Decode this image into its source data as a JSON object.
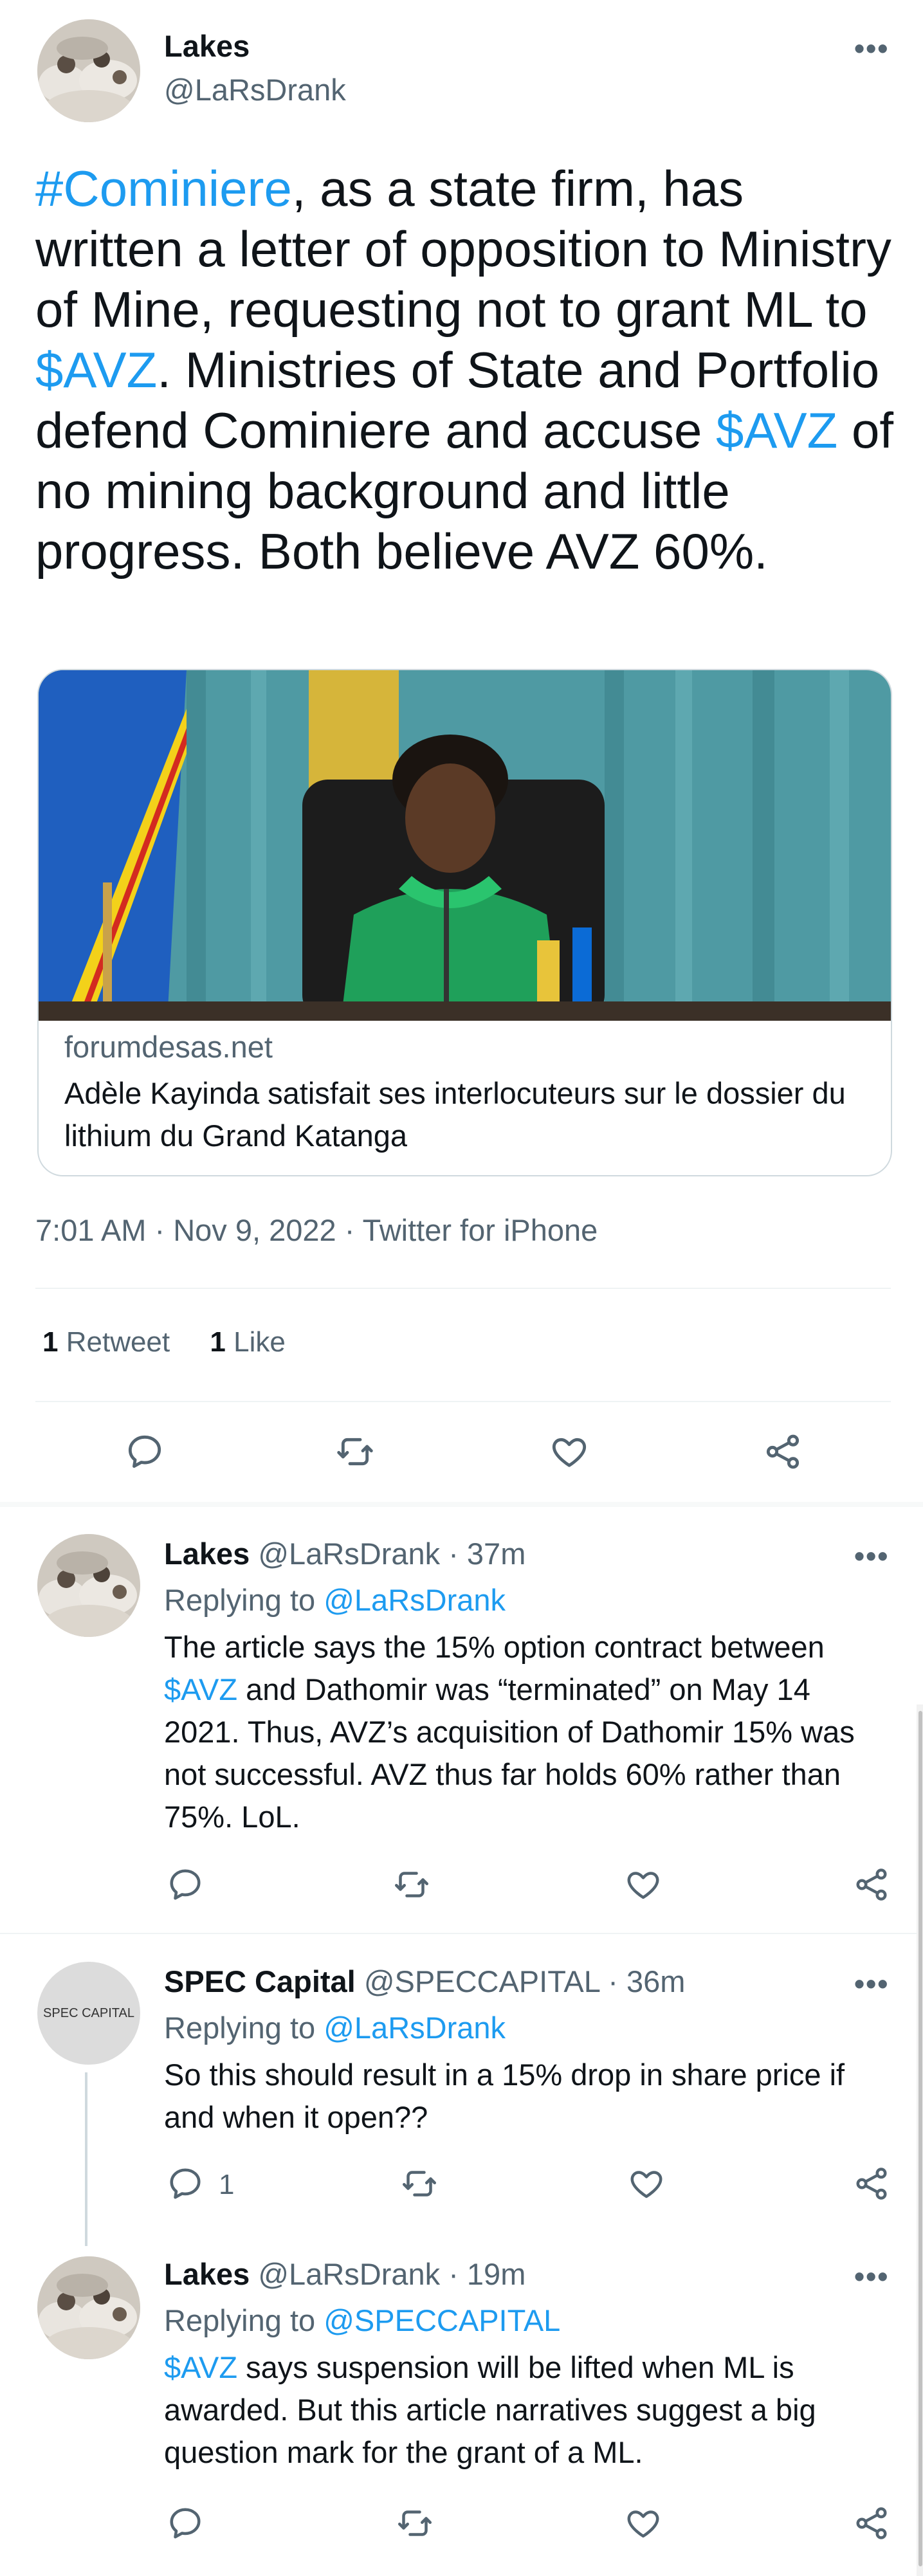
{
  "main_tweet": {
    "author_name": "Lakes",
    "author_handle": "@LaRsDrank",
    "text_parts": [
      "#Cominiere",
      ", as a state firm, has written a letter of opposition to Ministry of Mine, requesting not to grant ML to ",
      "$AVZ",
      ". Ministries of State and Portfolio defend Cominiere and accuse ",
      "$AVZ",
      " of no mining background and little progress.  Both believe AVZ 60%."
    ],
    "card": {
      "domain": "forumdesas.net",
      "title": "Adèle Kayinda satisfait ses interlocuteurs sur le dossier du lithium du Grand Katanga"
    },
    "timestamp": "7:01 AM · Nov 9, 2022 · Twitter for iPhone",
    "retweets_count": "1",
    "retweets_label": "Retweet",
    "likes_count": "1",
    "likes_label": "Like"
  },
  "replies": [
    {
      "author_name": "Lakes",
      "author_handle": "@LaRsDrank · 37m",
      "replying_prefix": "Replying to ",
      "replying_to": "@LaRsDrank",
      "text_parts": [
        "The article says the 15% option contract between ",
        "$AVZ",
        " and Dathomir was “terminated” on May 14 2021. Thus, AVZ’s acquisition of Dathomir 15% was not successful. AVZ thus far holds 60% rather than 75%. LoL."
      ],
      "reply_count": ""
    },
    {
      "author_name": "SPEC Capital",
      "author_handle": "@SPECCAPITAL · 36m",
      "avatar_text": "SPEC CAPITAL",
      "replying_prefix": "Replying to ",
      "replying_to": "@LaRsDrank",
      "text": "So this should result in a 15% drop in share price if and when it open??",
      "reply_count": "1"
    },
    {
      "author_name": "Lakes",
      "author_handle": "@LaRsDrank · 19m",
      "replying_prefix": "Replying to ",
      "replying_to": "@SPECCAPITAL",
      "text_parts": [
        "$AVZ",
        " says suspension will be lifted when ML is awarded. But this article narratives suggest a big question mark for the grant of a ML."
      ],
      "reply_count": ""
    }
  ],
  "more_glyph": "•••",
  "colors": {
    "link": "#1d9bf0",
    "muted": "#536471",
    "text": "#0f1419",
    "divider": "#eff3f4"
  }
}
